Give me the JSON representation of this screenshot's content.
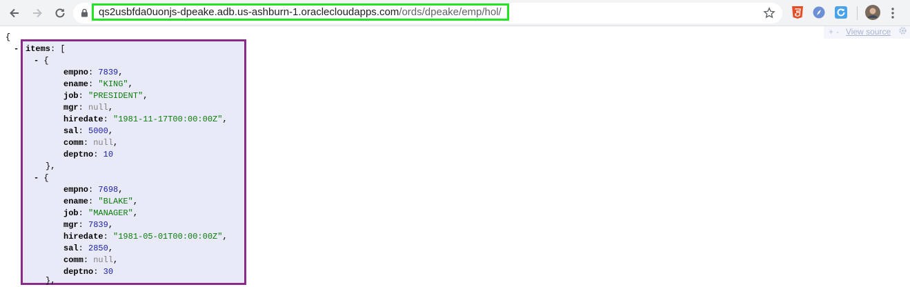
{
  "browser": {
    "url_host": "qs2usbfda0uonjs-dpeake.adb.us-ashburn-1.oraclecloudapps.com",
    "url_path": "/ords/dpeake/emp/hol/",
    "highlight_color": "#22e622"
  },
  "viewer": {
    "plus": "+",
    "minus": "-",
    "view_source": "View source"
  },
  "json": {
    "open_brace": "{",
    "collapse": "-",
    "items_key": "items",
    "items_open": "[",
    "box_color": "#8a2a8a",
    "records": [
      {
        "fields": [
          {
            "key": "empno",
            "value": "7839",
            "type": "number"
          },
          {
            "key": "ename",
            "value": "\"KING\"",
            "type": "string"
          },
          {
            "key": "job",
            "value": "\"PRESIDENT\"",
            "type": "string"
          },
          {
            "key": "mgr",
            "value": "null",
            "type": "null"
          },
          {
            "key": "hiredate",
            "value": "\"1981-11-17T00:00:00Z\"",
            "type": "string"
          },
          {
            "key": "sal",
            "value": "5000",
            "type": "number"
          },
          {
            "key": "comm",
            "value": "null",
            "type": "null"
          },
          {
            "key": "deptno",
            "value": "10",
            "type": "number"
          }
        ]
      },
      {
        "fields": [
          {
            "key": "empno",
            "value": "7698",
            "type": "number"
          },
          {
            "key": "ename",
            "value": "\"BLAKE\"",
            "type": "string"
          },
          {
            "key": "job",
            "value": "\"MANAGER\"",
            "type": "string"
          },
          {
            "key": "mgr",
            "value": "7839",
            "type": "number"
          },
          {
            "key": "hiredate",
            "value": "\"1981-05-01T00:00:00Z\"",
            "type": "string"
          },
          {
            "key": "sal",
            "value": "2850",
            "type": "number"
          },
          {
            "key": "comm",
            "value": "null",
            "type": "null"
          },
          {
            "key": "deptno",
            "value": "30",
            "type": "number"
          }
        ]
      }
    ]
  }
}
